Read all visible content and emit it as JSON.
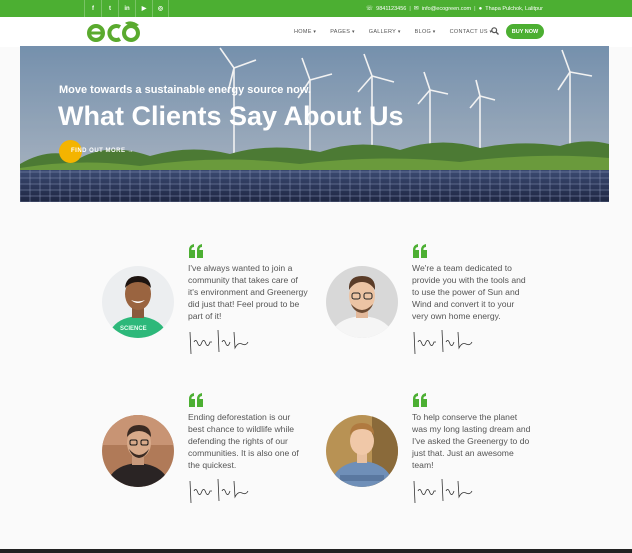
{
  "topbar": {
    "social_icons": [
      "facebook-icon",
      "twitter-icon",
      "linkedin-icon",
      "youtube-icon",
      "instagram-icon"
    ],
    "social_glyphs": [
      "f",
      "t",
      "in",
      "▶",
      "◎"
    ],
    "phone": "9841123456",
    "email": "info@ecogreen.com",
    "location": "Thapa Pulchok, Lalitpur"
  },
  "nav": {
    "logo_text": "eco",
    "menu": [
      "HOME",
      "PAGES",
      "GALLERY",
      "BLOG",
      "CONTACT US"
    ],
    "buy_label": "BUY NOW"
  },
  "hero": {
    "subtitle": "Move towards a sustainable energy source now.",
    "title": "What Clients Say About Us",
    "button_label": "FIND OUT MORE →"
  },
  "testimonials": [
    {
      "quote": "I've always wanted to join a community that takes care of it's environment and Greenergy did just that! Feel proud to be part of it!",
      "shirt_text": "SCIENCE"
    },
    {
      "quote": "We're a team dedicated to provide you with the tools and to use the power of Sun and Wind and convert it to your very own home energy."
    },
    {
      "quote": "Ending deforestation is our best chance to wildlife while defending the rights of our communities. It is also one of the quickest."
    },
    {
      "quote": "To help conserve the planet was my long lasting dream and I've asked the Greenergy to do just that. Just an awesome team!"
    }
  ],
  "colors": {
    "brand_green": "#4caf32",
    "accent_yellow": "#f4b400"
  }
}
